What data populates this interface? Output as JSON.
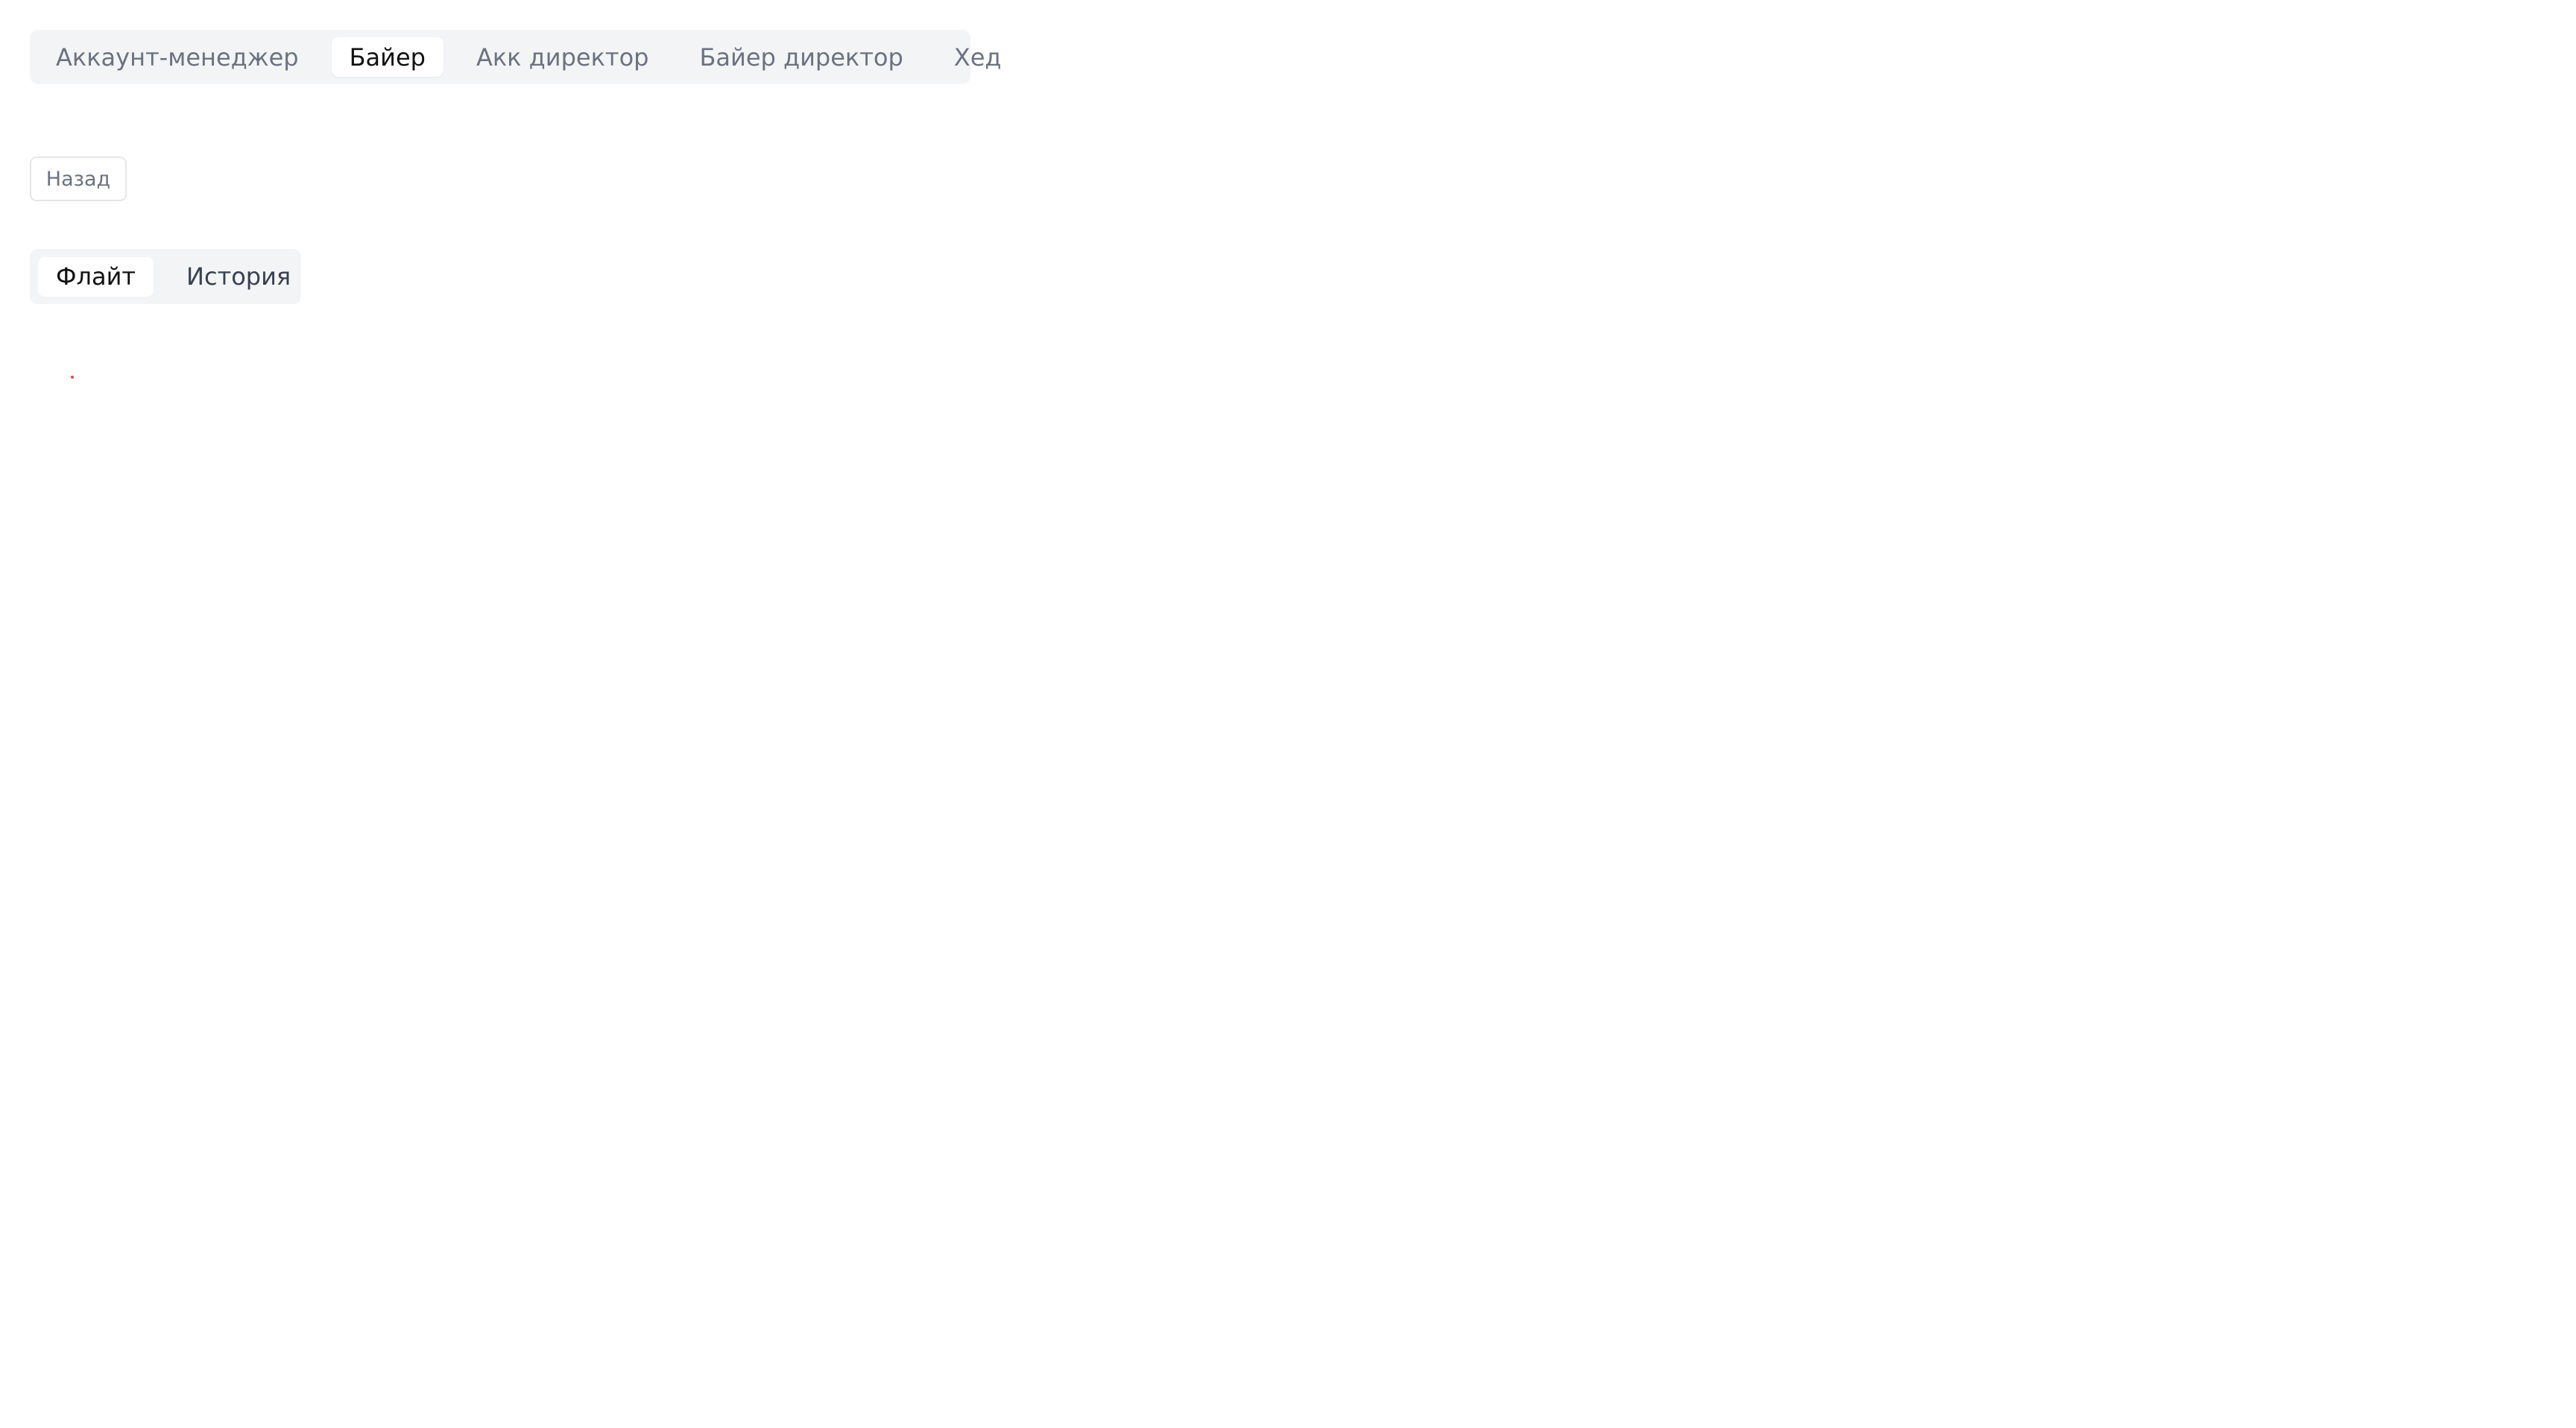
{
  "role_tabs": {
    "items": [
      {
        "label": "Аккаунт-менеджер",
        "active": false
      },
      {
        "label": "Байер",
        "active": true
      },
      {
        "label": "Акк директор",
        "active": false
      },
      {
        "label": "Байер директор",
        "active": false
      },
      {
        "label": "Хед",
        "active": false
      }
    ]
  },
  "back": {
    "label": "Назад"
  },
  "view_tabs": {
    "items": [
      {
        "label": "Флайт",
        "active": true
      },
      {
        "label": "История",
        "active": false
      }
    ]
  },
  "colors": {
    "tab_bar_bg": "#f3f4f6",
    "active_tab_bg": "#ffffff",
    "inactive_text": "#6b7280",
    "active_text": "#111111",
    "indicator": "#ef4444"
  }
}
